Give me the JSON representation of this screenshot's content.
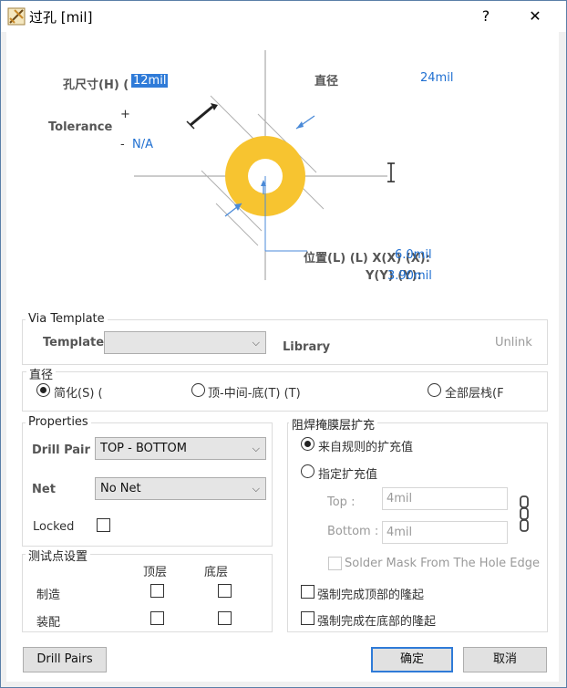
{
  "window": {
    "title": "过孔 [mil]",
    "help_label": "?",
    "close_label": "✕"
  },
  "preview": {
    "hole_size_label": "孔尺寸(H) (",
    "hole_size_value": "12mil",
    "tolerance_label": "Tolerance",
    "tolerance_plus": "+",
    "tolerance_minus": "-",
    "tolerance_minus_value": "N/A",
    "diameter_label": "直径",
    "diameter_value": "24mil",
    "location_label": "位置(L) (L) X(X) (X):",
    "location_x_value": "6.0mil",
    "location_y_label": "Y(Y) (Y):",
    "location_y_value": "3.90mil",
    "ring_color": "#f7c430"
  },
  "via_template": {
    "group_label": "Via Template",
    "template_label": "Template",
    "template_value": "",
    "library_label": "Library",
    "unlink_label": "Unlink"
  },
  "diameter_mode": {
    "group_label": "直径",
    "options": [
      {
        "label": "简化(S) (",
        "checked": true
      },
      {
        "label": "顶-中间-底(T) (T)",
        "checked": false
      },
      {
        "label": "全部层栈(F",
        "checked": false
      }
    ]
  },
  "properties": {
    "group_label": "Properties",
    "drill_pair_label": "Drill Pair",
    "drill_pair_value": "TOP - BOTTOM",
    "net_label": "Net",
    "net_value": "No Net",
    "locked_label": "Locked"
  },
  "testpoint": {
    "group_label": "测试点设置",
    "top_layer_label": "顶层",
    "bottom_layer_label": "底层",
    "fabrication_label": "制造",
    "assembly_label": "装配"
  },
  "solder_mask": {
    "group_label": "阻焊掩膜层扩充",
    "from_rules_label": "来自规则的扩充值",
    "specified_label": "指定扩充值",
    "top_label": "Top :",
    "top_value": "4mil",
    "bottom_label": "Bottom :",
    "bottom_value": "4mil",
    "from_hole_edge_label": "Solder Mask From The Hole Edge",
    "force_top_tent_label": "强制完成顶部的隆起",
    "force_bottom_tent_label": "强制完成在底部的隆起"
  },
  "footer": {
    "drill_pairs_label": "Drill Pairs",
    "ok_label": "确定",
    "cancel_label": "取消"
  }
}
